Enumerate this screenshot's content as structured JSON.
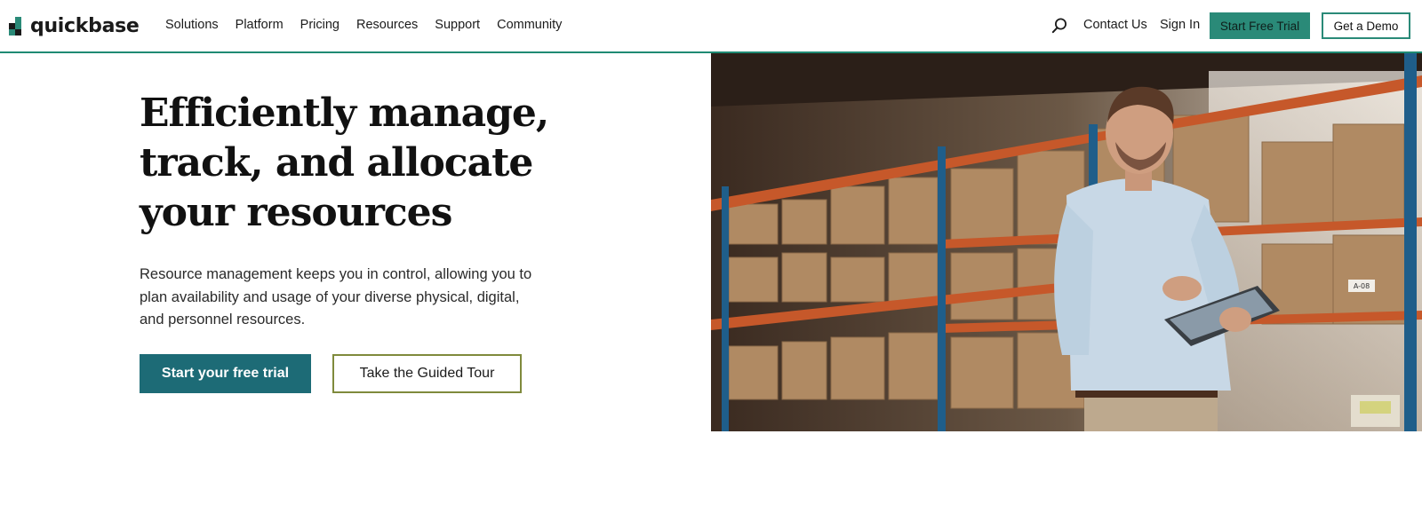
{
  "brand": {
    "name": "quickbase",
    "colors": {
      "accent": "#2a8a78",
      "primary_button": "#1d6b76",
      "outline_button": "#7f8a3c",
      "logo_dark": "#1a1a1a",
      "logo_green": "#2a8a78"
    }
  },
  "nav": {
    "items": [
      "Solutions",
      "Platform",
      "Pricing",
      "Resources",
      "Support",
      "Community"
    ]
  },
  "header_right": {
    "search_icon": "search-icon",
    "contact": "Contact Us",
    "sign_in": "Sign In",
    "start_trial": "Start Free Trial",
    "get_demo": "Get a Demo"
  },
  "hero": {
    "title_lines": [
      "Efficiently manage,",
      "track, and allocate",
      "your resources"
    ],
    "description_lines": [
      "Resource management keeps you in control, allowing you to",
      "plan availability and usage of your diverse physical, digital,",
      "and personnel resources."
    ],
    "primary_cta": "Start your free trial",
    "secondary_cta": "Take the Guided Tour"
  },
  "photo": {
    "subject": "warehouse-worker-with-tablet-photo",
    "shelf_label": "A-08"
  }
}
